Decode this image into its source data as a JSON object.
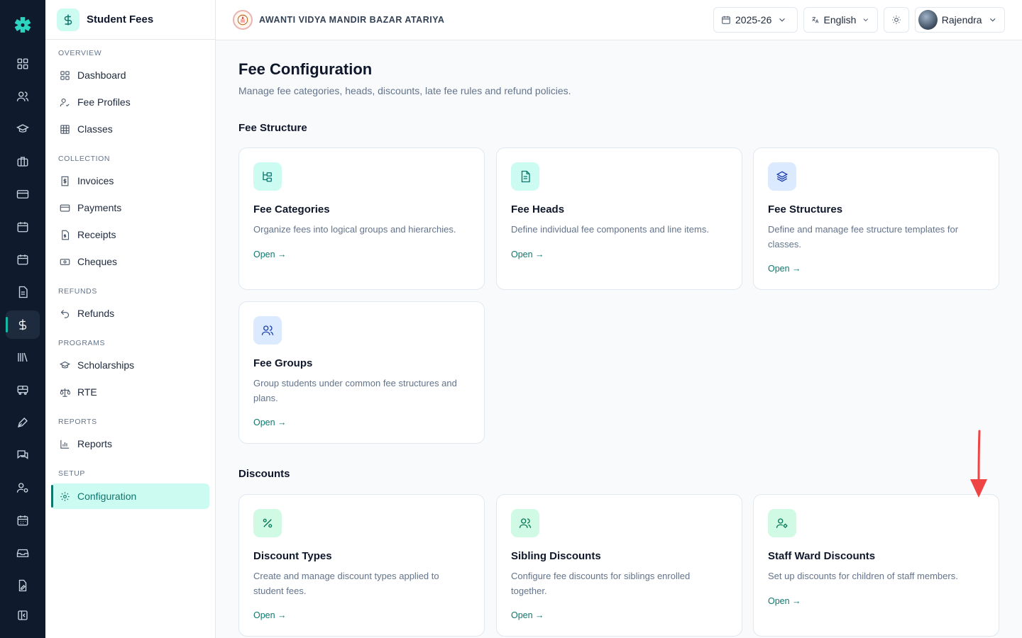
{
  "app": {
    "module_title": "Student Fees",
    "school_name": "AWANTI VIDYA MANDIR BAZAR ATARIYA"
  },
  "rail": {
    "icons": [
      "dashboard-icon",
      "users-icon",
      "graduation-cap-icon",
      "briefcase-icon",
      "card-icon",
      "calendar-icon",
      "calendar-icon",
      "document-icon",
      "dollar-icon",
      "library-icon",
      "bus-icon",
      "pen-icon",
      "messages-icon",
      "user-settings-icon",
      "calendar-grid-icon",
      "inbox-icon",
      "file-edit-icon",
      "panel-collapse-icon"
    ],
    "active_index": 8
  },
  "sidebar": {
    "sections": [
      {
        "label": "OVERVIEW",
        "items": [
          {
            "label": "Dashboard",
            "icon": "grid-icon"
          },
          {
            "label": "Fee Profiles",
            "icon": "user-check-icon"
          },
          {
            "label": "Classes",
            "icon": "table-icon"
          }
        ]
      },
      {
        "label": "COLLECTION",
        "items": [
          {
            "label": "Invoices",
            "icon": "invoice-icon"
          },
          {
            "label": "Payments",
            "icon": "card-icon"
          },
          {
            "label": "Receipts",
            "icon": "receipt-icon"
          },
          {
            "label": "Cheques",
            "icon": "banknote-icon"
          }
        ]
      },
      {
        "label": "REFUNDS",
        "items": [
          {
            "label": "Refunds",
            "icon": "undo-icon"
          }
        ]
      },
      {
        "label": "PROGRAMS",
        "items": [
          {
            "label": "Scholarships",
            "icon": "graduation-cap-icon"
          },
          {
            "label": "RTE",
            "icon": "scale-icon"
          }
        ]
      },
      {
        "label": "REPORTS",
        "items": [
          {
            "label": "Reports",
            "icon": "bar-chart-icon"
          }
        ]
      },
      {
        "label": "SETUP",
        "items": [
          {
            "label": "Configuration",
            "icon": "gear-icon",
            "active": true
          }
        ]
      }
    ]
  },
  "topbar": {
    "year": "2025-26",
    "language": "English",
    "user": "Rajendra"
  },
  "page": {
    "title": "Fee Configuration",
    "subtitle": "Manage fee categories, heads, discounts, late fee rules and refund policies."
  },
  "sections": [
    {
      "title": "Fee Structure",
      "cards": [
        {
          "title": "Fee Categories",
          "description": "Organize fees into logical groups and hierarchies.",
          "open": "Open →",
          "icon": "hierarchy-icon",
          "tone": "teal"
        },
        {
          "title": "Fee Heads",
          "description": "Define individual fee components and line items.",
          "open": "Open →",
          "icon": "document-icon",
          "tone": "teal"
        },
        {
          "title": "Fee Structures",
          "description": "Define and manage fee structure templates for classes.",
          "open": "Open →",
          "icon": "layers-icon",
          "tone": "blue"
        },
        {
          "title": "Fee Groups",
          "description": "Group students under common fee structures and plans.",
          "open": "Open →",
          "icon": "users-icon",
          "tone": "blue"
        }
      ]
    },
    {
      "title": "Discounts",
      "cards": [
        {
          "title": "Discount Types",
          "description": "Create and manage discount types applied to student fees.",
          "open": "Open →",
          "icon": "percent-icon",
          "tone": "green"
        },
        {
          "title": "Sibling Discounts",
          "description": "Configure fee discounts for siblings enrolled together.",
          "open": "Open →",
          "icon": "users-icon",
          "tone": "green"
        },
        {
          "title": "Staff Ward Discounts",
          "description": "Set up discounts for children of staff members.",
          "open": "Open →",
          "icon": "user-gear-icon",
          "tone": "green"
        }
      ]
    }
  ],
  "colors": {
    "accent": "#0f766e",
    "accent_bg": "#ccfbf1",
    "rail_bg": "#0f1b2d",
    "annotation_arrow": "#ef4444"
  }
}
